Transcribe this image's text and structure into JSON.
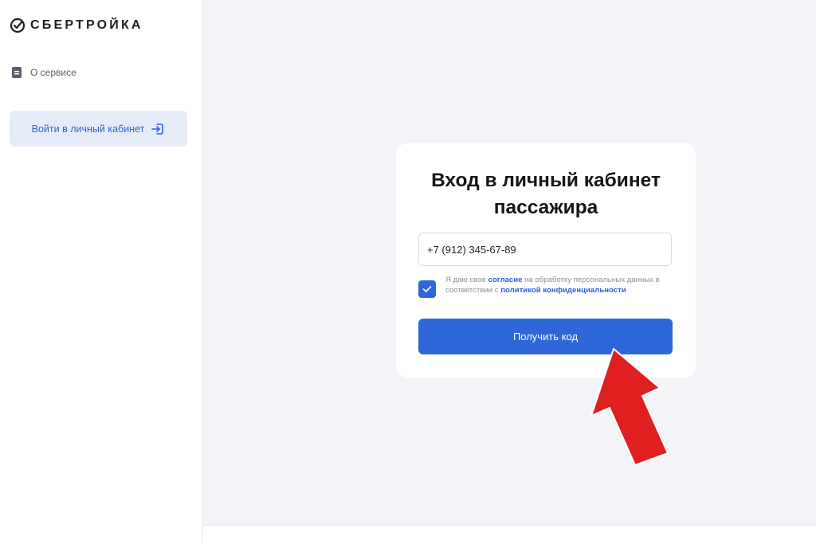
{
  "brand": {
    "logo_text": "СБЕРТРОЙКА",
    "accent": "#21a038"
  },
  "sidebar": {
    "about_label": "О сервисе",
    "login_label": "Войти в личный кабинет"
  },
  "login_card": {
    "title_line1": "Вход в личный кабинет",
    "title_line2": "пассажира",
    "phone_value": "+7 (912) 345-67-89",
    "consent_checked": true,
    "consent_text_1": "Я даю свое ",
    "consent_link_1": "согласие",
    "consent_text_2": " на обработку персональных данных в соответствии с ",
    "consent_link_2": "политикой конфиденциальности",
    "submit_label": "Получить код"
  },
  "colors": {
    "primary": "#2f67d8",
    "page_background": "#f3f4f8",
    "annotation_arrow": "#e02020"
  }
}
